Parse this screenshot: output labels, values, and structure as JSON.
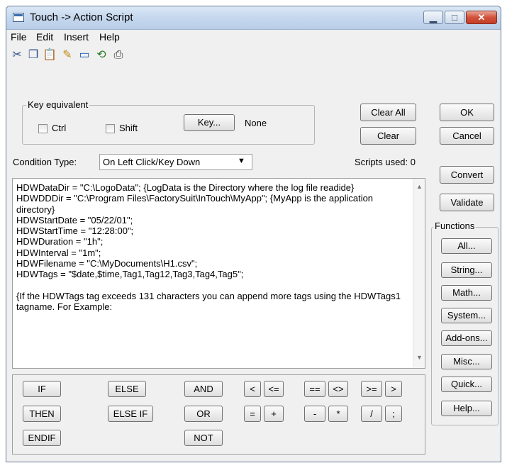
{
  "window": {
    "title": "Touch -> Action Script"
  },
  "menu": [
    "File",
    "Edit",
    "Insert",
    "Help"
  ],
  "toolbar_icons": [
    {
      "name": "cut-icon",
      "glyph": "✂",
      "color": "#2b4a8a"
    },
    {
      "name": "copy-icon",
      "glyph": "❐",
      "color": "#2b4a8a"
    },
    {
      "name": "paste-icon",
      "glyph": "📋",
      "color": "#a07a20"
    },
    {
      "name": "find-icon",
      "glyph": "✎",
      "color": "#c08a10"
    },
    {
      "name": "window-icon",
      "glyph": "▭",
      "color": "#1a5ab0"
    },
    {
      "name": "replace-icon",
      "glyph": "⟲",
      "color": "#2a7a2a"
    },
    {
      "name": "print-icon",
      "glyph": "⎙",
      "color": "#333333"
    }
  ],
  "key_equivalent": {
    "group_label": "Key equivalent",
    "ctrl_label": "Ctrl",
    "shift_label": "Shift",
    "key_button": "Key...",
    "key_value": "None"
  },
  "buttons": {
    "clear_all": "Clear All",
    "clear": "Clear",
    "ok": "OK",
    "cancel": "Cancel",
    "convert": "Convert",
    "validate": "Validate"
  },
  "condition": {
    "label": "Condition Type:",
    "value": "On Left Click/Key Down"
  },
  "scripts_used": "Scripts used: 0",
  "functions": {
    "label": "Functions",
    "items": [
      "All...",
      "String...",
      "Math...",
      "System...",
      "Add-ons...",
      "Misc...",
      "Quick...",
      "Help..."
    ]
  },
  "script_text": "HDWDataDir = \"C:\\LogoData\"; {LogData is the Directory where the log file readide}\nHDWDDDir = \"C:\\Program Files\\FactorySuit\\InTouch\\MyApp\"; {MyApp is the application directory}\nHDWStartDate = \"05/22/01\";\nHDWStartTime = \"12:28:00\";\nHDWDuration = \"1h\";\nHDWInterval = \"1m\";\nHDWFilename = \"C:\\MyDocuments\\H1.csv\";\nHDWTags = \"$date,$time,Tag1,Tag12,Tag3,Tag4,Tag5\";\n\n{If the HDWTags tag exceeds 131 characters you can append more tags using the HDWTags1 tagname. For Example:",
  "operators": [
    "IF",
    "ELSE",
    "AND",
    "<",
    "<=",
    "==",
    "<>",
    ">=",
    ">",
    "THEN",
    "ELSE IF",
    "OR",
    "=",
    "+",
    "-",
    "*",
    "/",
    ";",
    "ENDIF",
    "NOT"
  ]
}
